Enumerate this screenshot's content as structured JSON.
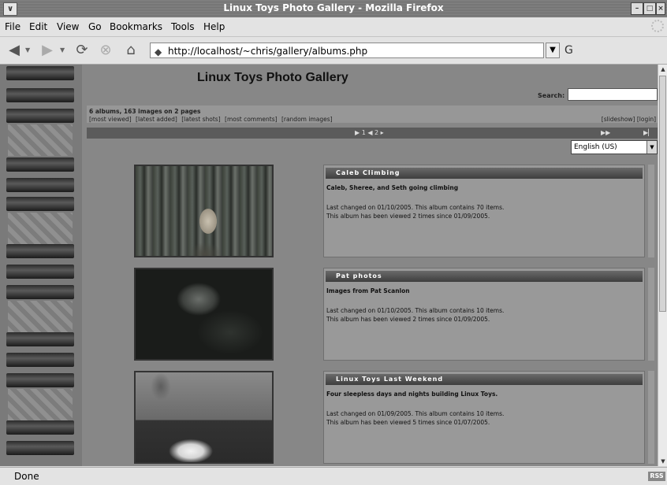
{
  "window": {
    "title": "Linux Toys Photo Gallery - Mozilla Firefox",
    "sys_menu_icon": "down-chevron",
    "controls": [
      "minimize",
      "maximize",
      "close"
    ]
  },
  "menubar": {
    "items": [
      "File",
      "Edit",
      "View",
      "Go",
      "Bookmarks",
      "Tools",
      "Help"
    ]
  },
  "navbar": {
    "back_icon": "◀",
    "forward_icon": "▶",
    "reload_icon": "⟳",
    "stop_icon": "⊗",
    "home_icon": "⌂",
    "url": "http://localhost/~chris/gallery/albums.php",
    "go_icon": "G"
  },
  "gallery": {
    "title": "Linux Toys Photo Gallery",
    "search_label": "Search:",
    "summary": "6 albums, 163 images on 2 pages",
    "links": [
      "[most viewed]",
      "[latest added]",
      "[latest shots]",
      "[most comments]",
      "[random images]"
    ],
    "right_links": [
      "[slideshow]",
      "[login]"
    ],
    "pager": "▶ 1 ◀ 2 ▸",
    "pager_next": "▶▶",
    "pager_last": "▶▏",
    "language": "English (US)"
  },
  "albums": [
    {
      "title": "Caleb Climbing",
      "description": "Caleb, Sheree, and Seth going climbing",
      "changed": "Last changed on 01/10/2005. This album contains 70 items.",
      "viewed": "This album has been viewed 2 times since 01/09/2005."
    },
    {
      "title": "Pat photos",
      "description": "Images from Pat Scanlon",
      "changed": "Last changed on 01/10/2005. This album contains 10 items.",
      "viewed": "This album has been viewed 2 times since 01/09/2005."
    },
    {
      "title": "Linux Toys Last Weekend",
      "description": "Four sleepless days and nights building Linux Toys.",
      "changed": "Last changed on 01/09/2005. This album contains 10 items.",
      "viewed": "This album has been viewed 5 times since 01/07/2005."
    }
  ],
  "statusbar": {
    "status": "Done",
    "rss": "RSS"
  }
}
